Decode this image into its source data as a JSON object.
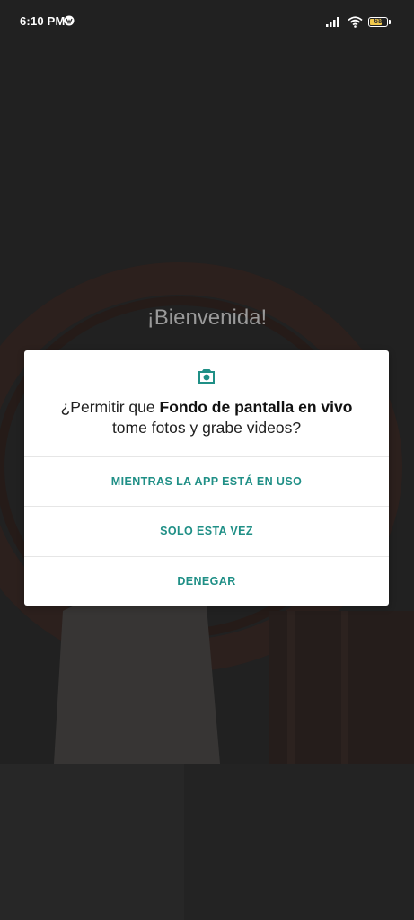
{
  "status_bar": {
    "time": "6:10 PM",
    "battery_level": "68"
  },
  "background": {
    "welcome_text": "¡Bienvenida!"
  },
  "permission_dialog": {
    "icon": "camera-icon",
    "title_prefix": "¿Permitir que ",
    "app_name": "Fondo de pantalla en vivo",
    "title_suffix": "tome fotos y grabe videos?",
    "buttons": {
      "while_in_use": "MIENTRAS LA APP ESTÁ EN USO",
      "only_this_time": "SOLO ESTA VEZ",
      "deny": "DENEGAR"
    }
  },
  "colors": {
    "accent": "#1f8f86",
    "dialog_bg": "#ffffff",
    "scrim": "#262626"
  }
}
